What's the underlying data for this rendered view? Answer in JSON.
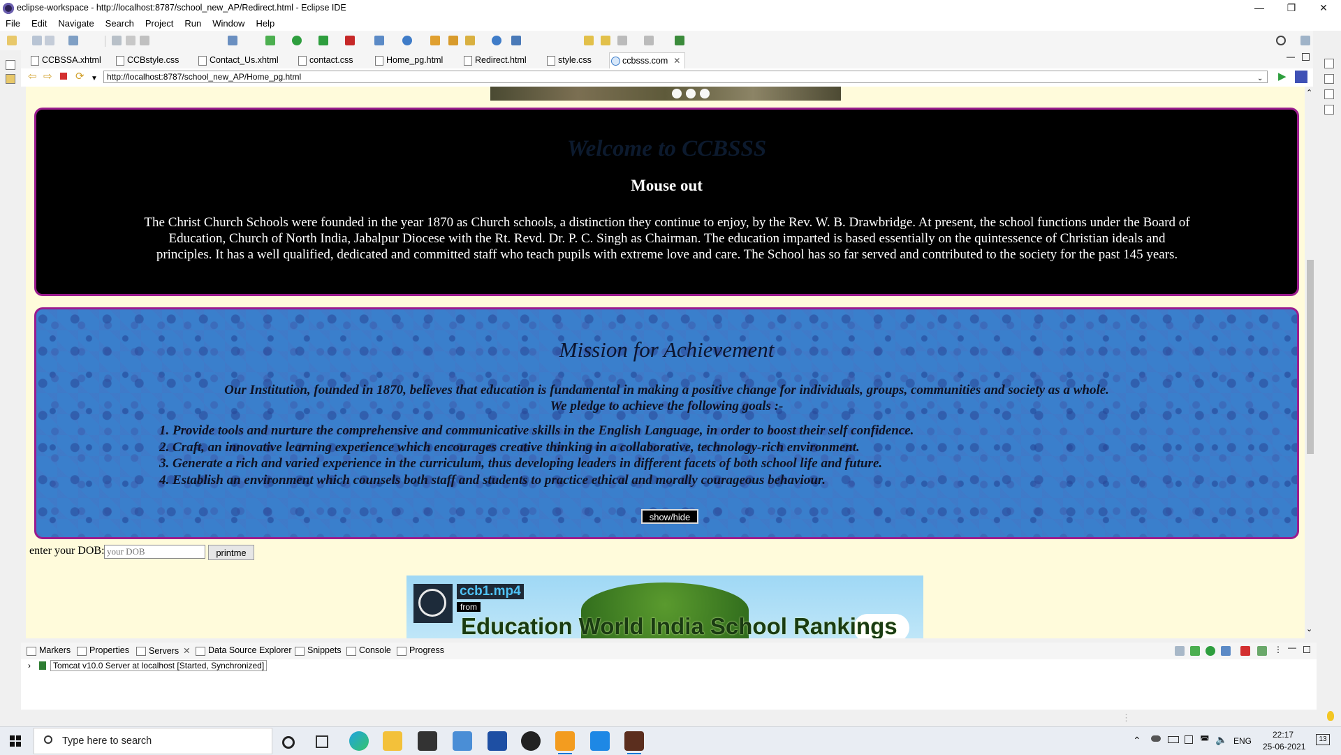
{
  "window": {
    "title": "eclipse-workspace - http://localhost:8787/school_new_AP/Redirect.html - Eclipse IDE"
  },
  "menu": [
    "File",
    "Edit",
    "Navigate",
    "Search",
    "Project",
    "Run",
    "Window",
    "Help"
  ],
  "editor_tabs": [
    "CCBSSA.xhtml",
    "CCBstyle.css",
    "Contact_Us.xhtml",
    "contact.css",
    "Home_pg.html",
    "Redirect.html",
    "style.css",
    "ccbsss.com"
  ],
  "address": {
    "url": "http://localhost:8787/school_new_AP/Home_pg.html"
  },
  "page": {
    "welcome": {
      "heading": "Welcome to CCBSSS",
      "subheading": "Mouse out",
      "text": "The Christ Church Schools were founded in the year 1870 as Church schools, a distinction they continue to enjoy, by the Rev. W. B. Drawbridge. At present, the school functions under the Board of Education, Church of North India, Jabalpur Diocese with the Rt. Revd. Dr. P. C. Singh as Chairman. The education imparted is based essentially on the quintessence of Christian ideals and principles. It has a well qualified, dedicated and committed staff who teach pupils with extreme love and care. The School has so far served and contributed to the society for the past 145 years."
    },
    "mission": {
      "heading": "Mission for Achievement",
      "intro_line1": "Our Institution, founded in 1870, believes that education is fundamental in making a positive change for individuals, groups, communities and society as a whole.",
      "intro_line2": "We pledge to achieve the following goals :-",
      "goals": [
        "Provide tools and nurture the comprehensive and communicative skills in the English Language, in order to boost their self confidence.",
        "Craft, an innovative learning experience which encourages creative thinking in a collaborative, technology-rich environment.",
        "Generate a rich and varied experience in the curriculum, thus developing leaders in different facets of both school life and future.",
        "Establish an environment which counsels both staff and students to practice ethical and morally courageous behaviour."
      ],
      "button": "show/hide"
    },
    "dob": {
      "label": "enter your DOB:",
      "placeholder": "your DOB",
      "button": "printme"
    },
    "video": {
      "title": "ccb1.mp4",
      "from": "from",
      "banner": "Education World India School Rankings"
    }
  },
  "bottom_tabs": [
    "Markers",
    "Properties",
    "Servers",
    "Data Source Explorer",
    "Snippets",
    "Console",
    "Progress"
  ],
  "server": {
    "label": "Tomcat v10.0 Server at localhost  [Started, Synchronized]"
  },
  "taskbar": {
    "search_placeholder": "Type here to search",
    "lang": "ENG",
    "time": "22:17",
    "date": "25-06-2021",
    "notif_count": "13"
  }
}
